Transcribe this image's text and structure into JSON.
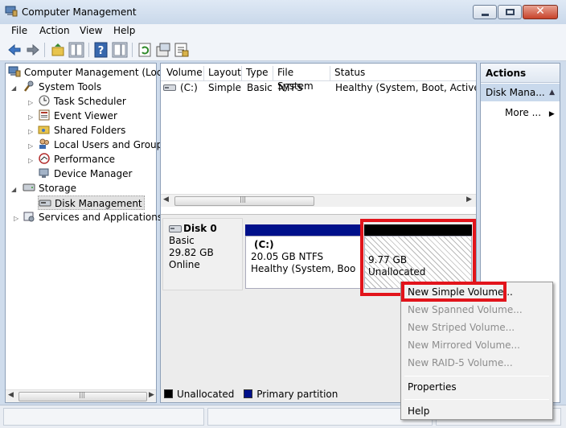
{
  "window": {
    "title": "Computer Management",
    "buttons": [
      "minimize",
      "maximize",
      "close"
    ]
  },
  "menu": [
    "File",
    "Action",
    "View",
    "Help"
  ],
  "toolbar_icons": [
    "back-icon",
    "forward-icon",
    "up-folder-icon",
    "show-hide-tree-icon",
    "help-icon",
    "show-hide-action-icon",
    "refresh-icon",
    "properties-icon",
    "export-icon"
  ],
  "tree": [
    {
      "label": "Computer Management (Local",
      "icon": "computer-icon"
    },
    {
      "label": "System Tools",
      "icon": "tools-icon"
    },
    {
      "label": "Task Scheduler",
      "icon": "clock-icon"
    },
    {
      "label": "Event Viewer",
      "icon": "event-viewer-icon"
    },
    {
      "label": "Shared Folders",
      "icon": "shared-folder-icon"
    },
    {
      "label": "Local Users and Groups",
      "icon": "users-icon"
    },
    {
      "label": "Performance",
      "icon": "performance-icon"
    },
    {
      "label": "Device Manager",
      "icon": "device-manager-icon"
    },
    {
      "label": "Storage",
      "icon": "storage-icon"
    },
    {
      "label": "Disk Management",
      "icon": "disk-management-icon"
    },
    {
      "label": "Services and Applications",
      "icon": "services-icon"
    }
  ],
  "volumes": {
    "columns": [
      "Volume",
      "Layout",
      "Type",
      "File System",
      "Status"
    ],
    "rows": [
      {
        "volume": "(C:)",
        "layout": "Simple",
        "type": "Basic",
        "fs": "NTFS",
        "status": "Healthy (System, Boot, Active, Pr"
      }
    ]
  },
  "disk": {
    "name": "Disk 0",
    "type": "Basic",
    "size": "29.82 GB",
    "state": "Online",
    "partitions": [
      {
        "label": "(C:)",
        "size": "20.05 GB NTFS",
        "status": "Healthy (System, Boot, A",
        "color": "#00108a"
      },
      {
        "size": "9.77 GB",
        "status": "Unallocated",
        "color": "#000000"
      }
    ]
  },
  "legend": [
    {
      "label": "Unallocated",
      "color": "#000000"
    },
    {
      "label": "Primary partition",
      "color": "#00108a"
    }
  ],
  "actions": {
    "header": "Actions",
    "section": "Disk Mana...",
    "more": "More ..."
  },
  "context_menu": {
    "items": [
      {
        "label": "New Simple Volume...",
        "enabled": true
      },
      {
        "label": "New Spanned Volume...",
        "enabled": false
      },
      {
        "label": "New Striped Volume...",
        "enabled": false
      },
      {
        "label": "New Mirrored Volume...",
        "enabled": false
      },
      {
        "label": "New RAID-5 Volume...",
        "enabled": false
      },
      {
        "label": "Properties",
        "enabled": true
      },
      {
        "label": "Help",
        "enabled": true
      }
    ]
  },
  "highlight_color": "#e2141b"
}
